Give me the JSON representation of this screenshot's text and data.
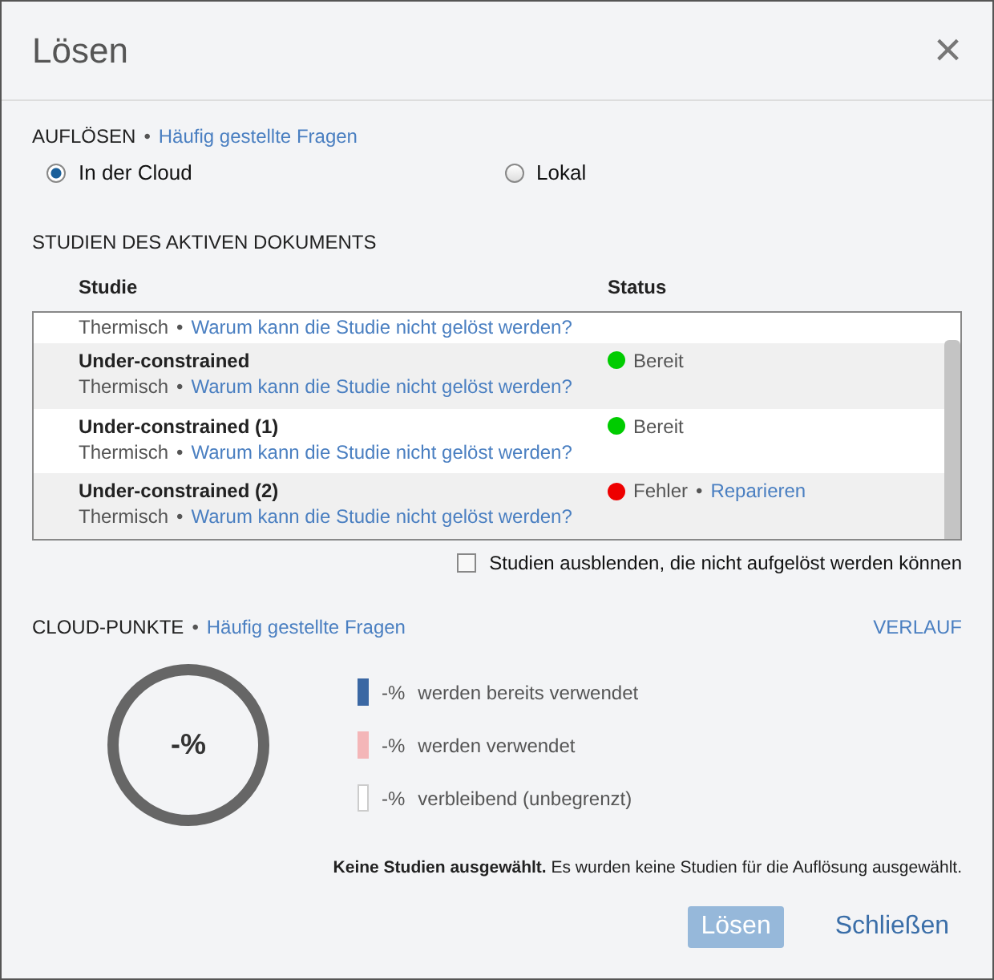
{
  "dialog": {
    "title": "Lösen",
    "close": "×"
  },
  "resolve": {
    "heading": "AUFLÖSEN",
    "separator": "•",
    "link": "Häufig gestellte Fragen",
    "options": [
      {
        "label": "In der Cloud",
        "selected": true
      },
      {
        "label": "Lokal",
        "selected": false
      }
    ]
  },
  "studies": {
    "heading": "STUDIEN DES AKTIVEN DOKUMENTS",
    "columns": [
      "Studie",
      "Status"
    ],
    "rows": [
      {
        "type": "Thermisch",
        "separator": "•",
        "link": "Warum kann die Studie nicht gelöst werden?"
      },
      {
        "name": "Under-constrained",
        "type": "Thermisch",
        "separator": "•",
        "link": "Warum kann die Studie nicht gelöst werden?",
        "status": "Bereit",
        "color": "#00cc00"
      },
      {
        "name": "Under-constrained (1)",
        "type": "Thermisch",
        "separator": "•",
        "link": "Warum kann die Studie nicht gelöst werden?",
        "status": "Bereit",
        "color": "#00cc00"
      },
      {
        "name": "Under-constrained (2)",
        "type": "Thermisch",
        "separator": "•",
        "link": "Warum kann die Studie nicht gelöst werden?",
        "status": "Fehler",
        "status_separator": "•",
        "action": "Reparieren",
        "color": "#ee0000"
      }
    ],
    "hide_unresolvable": {
      "label": "Studien ausblenden, die nicht aufgelöst werden können",
      "checked": false
    }
  },
  "cloud": {
    "heading": "CLOUD-PUNKTE",
    "separator": "•",
    "link": "Häufig gestellte Fragen",
    "history": "VERLAUF",
    "gauge": "-%",
    "legend": [
      {
        "value": "-%",
        "label": "werden bereits verwendet",
        "color": "#3a67a3"
      },
      {
        "value": "-%",
        "label": "werden verwendet",
        "color": "#f4b6b8"
      },
      {
        "value": "-%",
        "label": "verbleibend (unbegrenzt)",
        "color": "#ffffff"
      }
    ],
    "message": "**Keine Studien ausgewählt.** Es wurden keine Studien für die Auflösung ausgewählt."
  },
  "buttons": [
    {
      "label": "Lösen",
      "disabled": true
    },
    {
      "label": "Schließen",
      "disabled": false
    }
  ]
}
